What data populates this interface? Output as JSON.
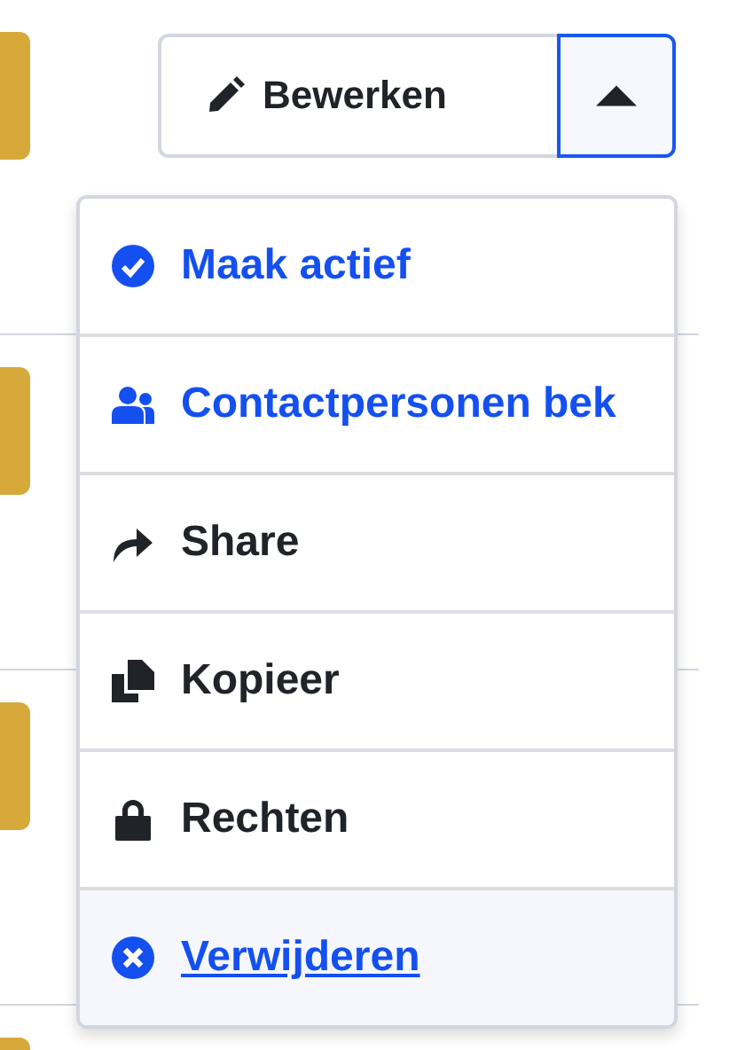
{
  "edit_button": {
    "label": "Bewerken",
    "menu_expanded": true
  },
  "menu": {
    "items": [
      {
        "label": "Maak actief",
        "kind": "primary",
        "highlighted": false
      },
      {
        "label": "Contactpersonen bek",
        "kind": "primary",
        "highlighted": false
      },
      {
        "label": "Share",
        "kind": "default",
        "highlighted": false
      },
      {
        "label": "Kopieer",
        "kind": "default",
        "highlighted": false
      },
      {
        "label": "Rechten",
        "kind": "default",
        "highlighted": false
      },
      {
        "label": "Verwijderen",
        "kind": "primary",
        "highlighted": true
      }
    ]
  }
}
